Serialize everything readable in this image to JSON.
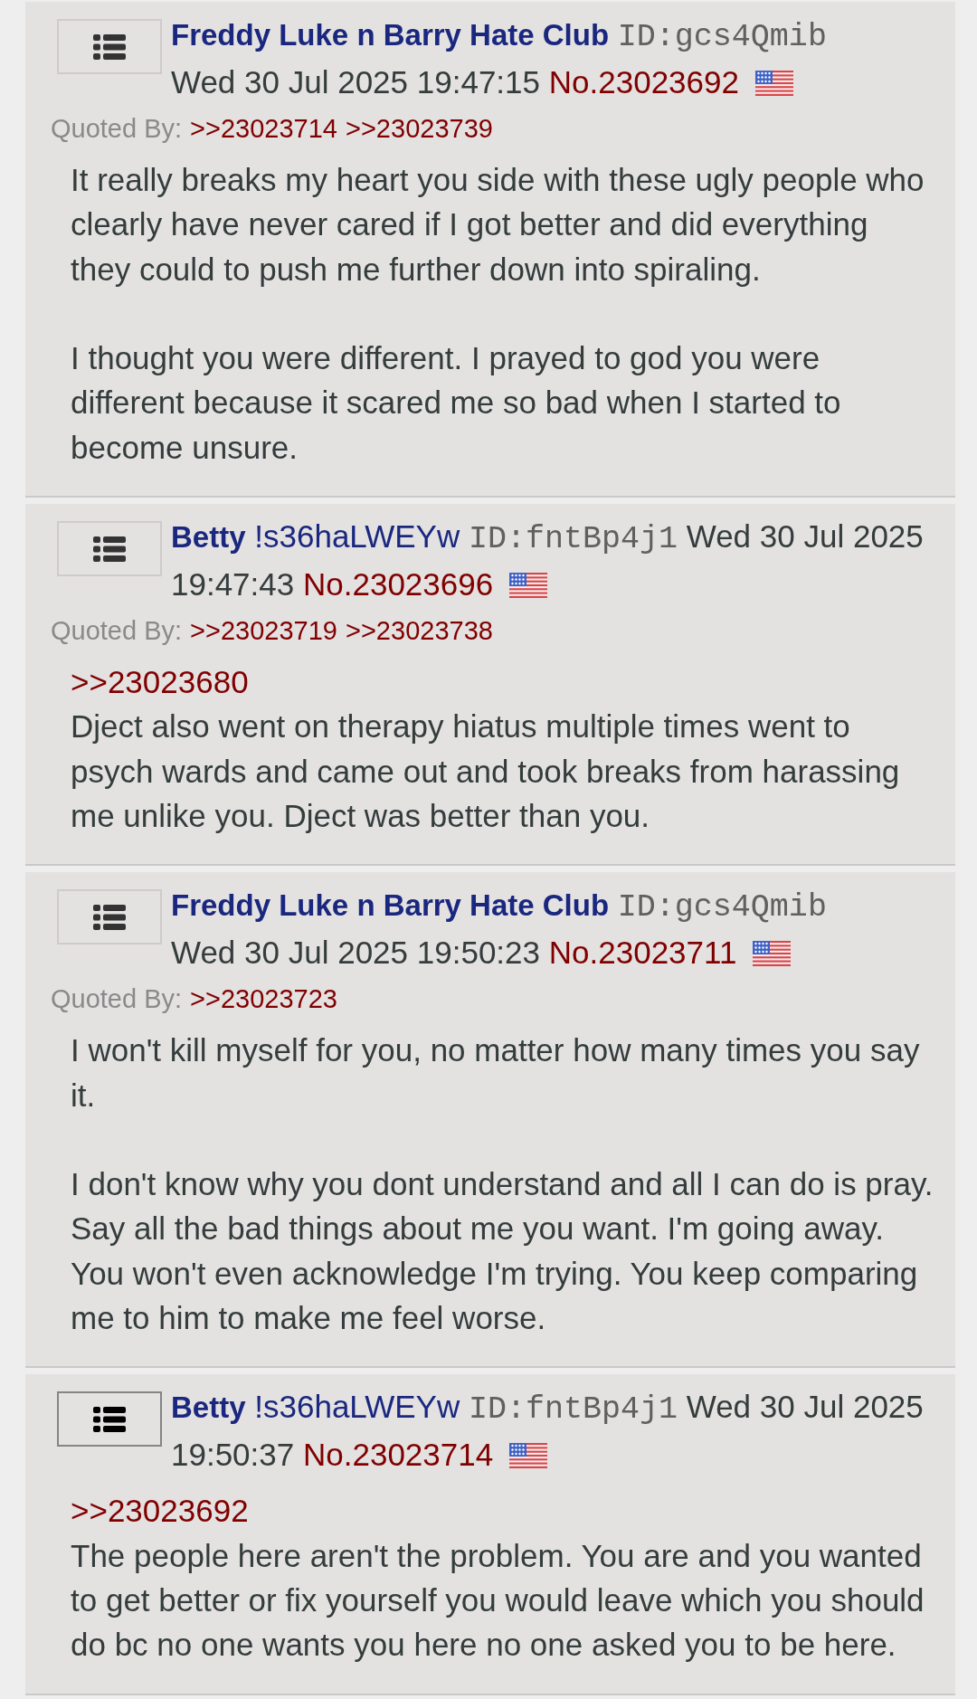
{
  "posts": [
    {
      "menu_focused": false,
      "name": "Freddy Luke n Barry Hate Club",
      "poster_id": "ID:gcs4Qmib",
      "date": "Wed 30 Jul 2025",
      "time": "19:47:15",
      "number": "No.23023692",
      "quoted_by": {
        "label": "Quoted By:",
        "links": [
          ">>23023714",
          ">>23023739"
        ]
      },
      "body": [
        {
          "kind": "paragraph",
          "text": "It really breaks my heart you side with these ugly people who clearly have never cared if I got better and did everything they could to push me further down into spiraling."
        },
        {
          "kind": "paragraph",
          "text": "I thought you were different. I prayed to god you were different because it scared me so bad when I started to become unsure."
        }
      ]
    },
    {
      "menu_focused": false,
      "name": "Betty",
      "tripcode": "!s36haLWEYw",
      "poster_id": "ID:fntBp4j1",
      "date": "Wed 30 Jul 2025",
      "time": "19:47:43",
      "number": "No.23023696",
      "quoted_by": {
        "label": "Quoted By:",
        "links": [
          ">>23023719",
          ">>23023738"
        ]
      },
      "body": [
        {
          "kind": "quotelink",
          "text": ">>23023680"
        },
        {
          "kind": "paragraph",
          "text": "Dject also went on therapy hiatus multiple times went to psych wards and came out and took breaks from harassing me unlike you. Dject was better than you."
        }
      ]
    },
    {
      "menu_focused": false,
      "name": "Freddy Luke n Barry Hate Club",
      "poster_id": "ID:gcs4Qmib",
      "date": "Wed 30 Jul 2025",
      "time": "19:50:23",
      "number": "No.23023711",
      "quoted_by": {
        "label": "Quoted By:",
        "links": [
          ">>23023723"
        ]
      },
      "body": [
        {
          "kind": "paragraph",
          "text": "I won't kill myself for you, no matter how many times you say it."
        },
        {
          "kind": "paragraph",
          "text": "I don't know why you dont understand and all I can do is pray. Say all the bad things about me you want. I'm going away. You won't even acknowledge I'm trying. You keep comparing me to him to make me feel worse."
        }
      ]
    },
    {
      "menu_focused": true,
      "name": "Betty",
      "tripcode": "!s36haLWEYw",
      "poster_id": "ID:fntBp4j1",
      "date": "Wed 30 Jul 2025",
      "time": "19:50:37",
      "number": "No.23023714",
      "body": [
        {
          "kind": "quotelink",
          "text": ">>23023692"
        },
        {
          "kind": "paragraph",
          "text": "The people here aren't the problem. You are and you wanted to get better or fix yourself you would leave which you should do bc no one wants you here no one asked you to be here."
        }
      ]
    }
  ]
}
